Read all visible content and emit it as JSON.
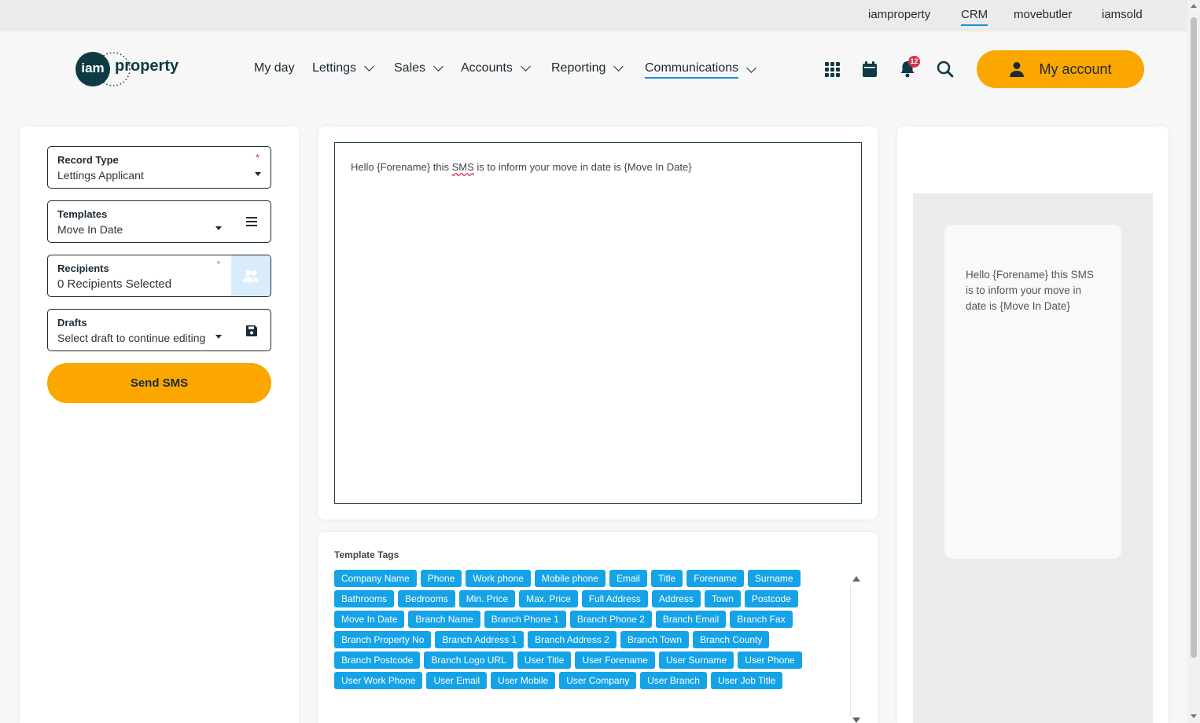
{
  "top_links": [
    "iamproperty",
    "CRM",
    "movebutler",
    "iamsold"
  ],
  "brand": {
    "mark": "iam",
    "word": "property"
  },
  "nav": {
    "my_day": "My day",
    "lettings": "Lettings",
    "sales": "Sales",
    "accounts": "Accounts",
    "reporting": "Reporting",
    "communications": "Communications"
  },
  "notifications_count": "12",
  "account_label": "My account",
  "form": {
    "record_type": {
      "label": "Record Type",
      "value": "Lettings Applicant",
      "required": "*"
    },
    "templates": {
      "label": "Templates",
      "value": "Move In Date"
    },
    "recipients": {
      "label": "Recipients",
      "value": "0 Recipients Selected",
      "required": "*"
    },
    "drafts": {
      "label": "Drafts",
      "value": "Select draft to continue editing"
    },
    "send_label": "Send SMS"
  },
  "editor": {
    "before": "Hello {Forename} this ",
    "misspelled": "SMS",
    "after": " is to inform your move in date is {Move In Date}"
  },
  "tags_title": "Template Tags",
  "tags": [
    "Company Name",
    "Phone",
    "Work phone",
    "Mobile phone",
    "Email",
    "Title",
    "Forename",
    "Surname",
    "Bathrooms",
    "Bedrooms",
    "Min. Price",
    "Max. Price",
    "Full Address",
    "Address",
    "Town",
    "Postcode",
    "Move In Date",
    "Branch Name",
    "Branch Phone 1",
    "Branch Phone 2",
    "Branch Email",
    "Branch Fax",
    "Branch Property No",
    "Branch Address 1",
    "Branch Address 2",
    "Branch Town",
    "Branch County",
    "Branch Postcode",
    "Branch Logo URL",
    "User Title",
    "User Forename",
    "User Surname",
    "User Phone",
    "User Work Phone",
    "User Email",
    "User Mobile",
    "User Company",
    "User Branch",
    "User Job Title"
  ],
  "preview_text": "Hello {Forename}  this SMS is to inform your move in date is {Move In Date}",
  "colors": {
    "accent": "#fca600",
    "tag": "#15a3e8",
    "brand_dark": "#0e3b43",
    "link_underline": "#1a8fd6",
    "badge": "#d6334a"
  }
}
